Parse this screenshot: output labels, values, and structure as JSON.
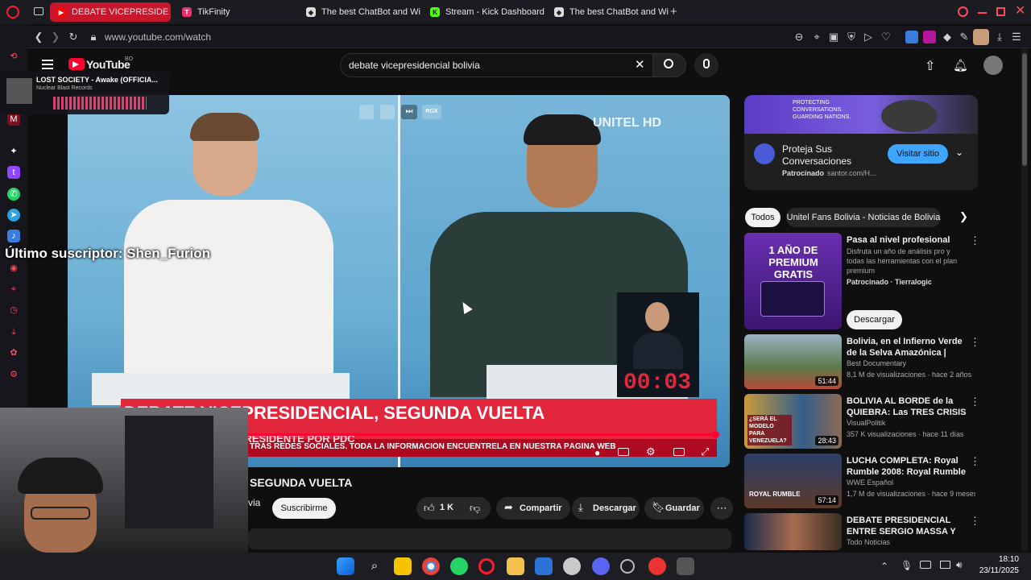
{
  "browser": {
    "tabs": [
      {
        "label": "DEBATE VICEPRESIDE",
        "active": true
      },
      {
        "label": "TikFinity"
      },
      {
        "label": "The best ChatBot and Wi"
      },
      {
        "label": "Stream - Kick Dashboard"
      },
      {
        "label": "The best ChatBot and Wi"
      }
    ],
    "url": "www.youtube.com/watch"
  },
  "music_widget": {
    "title": "LOST SOCIETY - Awake (OFFICIA...",
    "artist": "Nuclear Blast Records"
  },
  "overlay_text": "Último suscriptor: Shen_Furion",
  "youtube": {
    "logo": "YouTube",
    "country": "BO",
    "search_value": "debate vicepresidencial bolivia"
  },
  "video": {
    "channel_logo": "UNITEL HD",
    "top_controls": [
      "RGX"
    ],
    "timer": "00:03",
    "lower_third_title": "DEBATE VICEPRESIDENCIAL, SEGUNDA VUELTA",
    "lower_third_sub": "CANDIDATO A VICEPRESIDENTE POR PDC",
    "ticker": "TRAS REDES SOCIALES.     TODA LA INFORMACIÓN ENCUÉNTRELA EN NUESTRA PÁGINA WEB"
  },
  "below_video": {
    "title": "SEGUNDA VUELTA",
    "channel_partial": "via",
    "subscribe": "Suscribirme",
    "likes": "1 K",
    "share": "Compartir",
    "download": "Descargar",
    "save": "Guardar"
  },
  "ad": {
    "banner_text": "PROTECTING CONVERSATIONS. GUARDING NATIONS.",
    "title": "Proteja Sus Conversaciones",
    "sponsor": "Patrocinado",
    "source": "santor.com/H...",
    "cta": "Visitar sitio"
  },
  "chips": [
    "Todos",
    "Unitel Fans Bolivia - Noticias de Bolivia"
  ],
  "recommendations": [
    {
      "title": "Pasa al nivel profesional",
      "desc": "Disfruta un año de análisis pro y todas las herramientas con el plan premium",
      "meta": "Patrocinado · Tierralogic",
      "cta": "Descargar",
      "thumb_text": "1 AÑO DE PREMIUM GRATIS"
    },
    {
      "title": "Bolivia, en el Infierno Verde de la Selva Amazónica | Viajes M...",
      "channel": "Best Documentary",
      "meta": "8,1 M de visualizaciones · hace 2 años",
      "duration": "51:44"
    },
    {
      "title": "BOLIVIA AL BORDE de la QUIEBRA: Las TRES CRISIS qu...",
      "channel": "VisualPolitik",
      "meta": "357 K visualizaciones · hace 11 días",
      "duration": "28:43",
      "thumb_text": "¿SERÁ EL MODELO PARA VENEZUELA?"
    },
    {
      "title": "LUCHA COMPLETA: Royal Rumble 2008: Royal Rumble ...",
      "channel": "WWE Español",
      "meta": "1,7 M de visualizaciones · hace 9 meses",
      "duration": "57:14",
      "thumb_text": "ROYAL RUMBLE"
    },
    {
      "title": "DEBATE PRESIDENCIAL ENTRE SERGIO MASSA Y JAVIER MILEI",
      "channel": "Todo Noticias",
      "meta": ""
    }
  ],
  "taskbar": {
    "time": "18:10",
    "date": "23/11/2025"
  },
  "colors": {
    "accent": "#ff0033",
    "opera": "#ff1b2d",
    "ticker": "#e2263c"
  }
}
